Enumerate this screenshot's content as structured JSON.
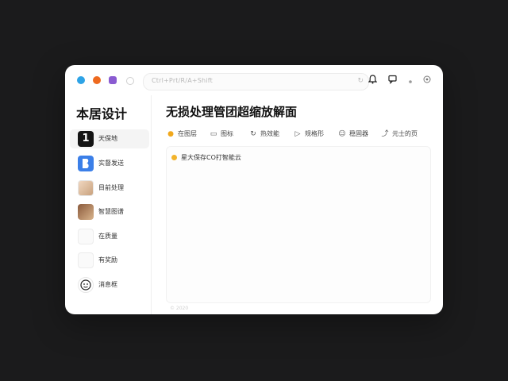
{
  "topbar": {
    "url_text": "Ctrl+Prt/R/A+Shift",
    "url_icon": "reload-icon",
    "icons": [
      "bell-icon",
      "chat-icon",
      "dot-icon",
      "settings-icon"
    ]
  },
  "sidebar": {
    "brand": "本居设计",
    "items": [
      {
        "label": "天保地",
        "avatar": "1",
        "avatar_icon": "number-one-icon"
      },
      {
        "label": "实督发送",
        "avatar": "",
        "avatar_icon": "blue-logo-icon"
      },
      {
        "label": "目前处理",
        "avatar": "",
        "avatar_icon": "avatar-photo-icon"
      },
      {
        "label": "智慧图谱",
        "avatar": "",
        "avatar_icon": "avatar-photo-icon"
      },
      {
        "label": "在质量",
        "avatar": "",
        "avatar_icon": "empty-avatar-icon"
      },
      {
        "label": "有奖励",
        "avatar": "",
        "avatar_icon": "empty-avatar-icon"
      },
      {
        "label": "消息框",
        "avatar": "",
        "avatar_icon": "face-icon"
      }
    ]
  },
  "main": {
    "title": "无损处理管团超缩放解面",
    "toolbar": [
      {
        "label": "在图层",
        "icon": "sun-icon"
      },
      {
        "label": "图标",
        "icon": "image-icon"
      },
      {
        "label": "热效能",
        "icon": "refresh-icon"
      },
      {
        "label": "规格形",
        "icon": "video-icon"
      },
      {
        "label": "稳固器",
        "icon": "smile-icon"
      },
      {
        "label": "元士的页",
        "icon": "share-icon"
      }
    ],
    "content_line": "星大保存CO打智能云",
    "footer": "© 2020"
  },
  "colors": {
    "background": "#1b1b1c",
    "window": "#ffffff",
    "accent_blue": "#2ea3e6",
    "accent_orange": "#ee6a1f",
    "accent_purple": "#8a5bd1",
    "accent_yellow": "#f2b32b"
  }
}
